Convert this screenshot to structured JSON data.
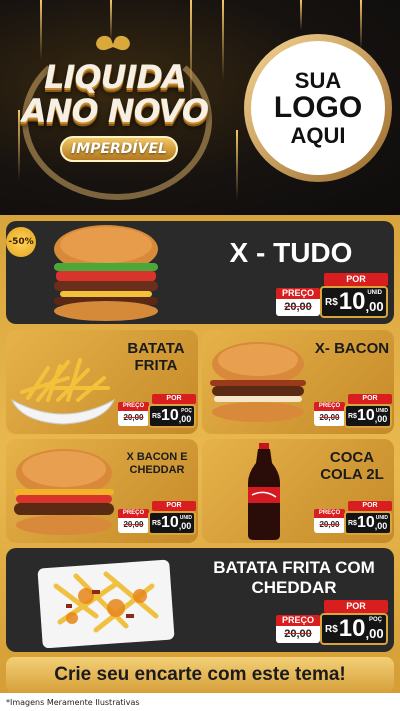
{
  "header": {
    "promo_line1": "LIQUIDA",
    "promo_line2": "ANO NOVO",
    "promo_badge": "IMPERDÍVEL",
    "logo_line1": "SUA",
    "logo_line2": "LOGO",
    "logo_line3": "AQUI"
  },
  "discount_badge": "-50%",
  "products": [
    {
      "name": "X - TUDO",
      "old_label": "PREÇO",
      "old_price": "20,00",
      "por": "POR",
      "currency": "R$",
      "price_int": "10",
      "price_cents": ",00",
      "unit": "UNID"
    },
    {
      "name": "BATATA FRITA",
      "old_label": "PREÇO",
      "old_price": "20,00",
      "por": "POR",
      "currency": "R$",
      "price_int": "10",
      "price_cents": ",00",
      "unit": "POÇ"
    },
    {
      "name": "X- BACON",
      "old_label": "PREÇO",
      "old_price": "20,00",
      "por": "POR",
      "currency": "R$",
      "price_int": "10",
      "price_cents": ",00",
      "unit": "UNID"
    },
    {
      "name": "X BACON E CHEDDAR",
      "old_label": "PREÇO",
      "old_price": "20,00",
      "por": "POR",
      "currency": "R$",
      "price_int": "10",
      "price_cents": ",00",
      "unit": "UNID"
    },
    {
      "name": "COCA COLA 2L",
      "old_label": "PREÇO",
      "old_price": "20,00",
      "por": "POR",
      "currency": "R$",
      "price_int": "10",
      "price_cents": ",00",
      "unit": "UNID"
    },
    {
      "name": "BATATA FRITA COM CHEDDAR",
      "old_label": "PREÇO",
      "old_price": "20,00",
      "por": "POR",
      "currency": "R$",
      "price_int": "10",
      "price_cents": ",00",
      "unit": "POÇ"
    }
  ],
  "footer": {
    "cta": "Crie seu encarte com este tema!",
    "disclaimer": "*Imagens Meramente Ilustrativas"
  },
  "colors": {
    "gold": "#d8a43c",
    "dark": "#2a2a2a",
    "red": "#d81e1e"
  }
}
